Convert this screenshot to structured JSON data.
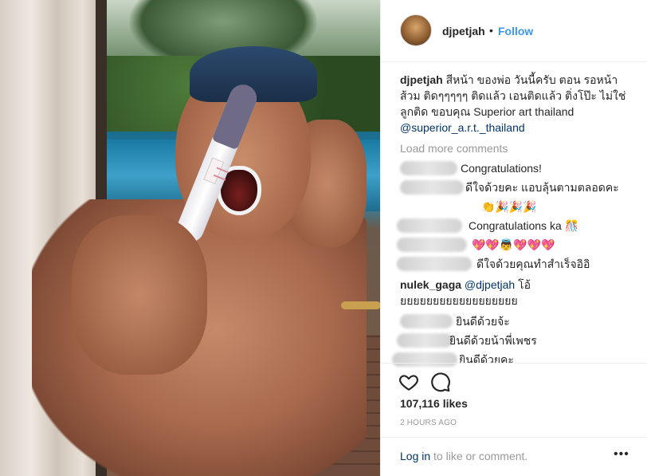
{
  "post": {
    "username": "djpetjah",
    "separator": "•",
    "follow_label": "Follow"
  },
  "caption": {
    "author": "djpetjah",
    "text": "สีหน้า ของพ่อ วันนี้ครับ ตอน รอหน้าส้วม ติดๆๆๆๆๆ ติดแล้ว เอนติดแล้ว ติ่งโป๊ะ ไม่ใช่ ลูกติด ขอบคุณ Superior art thailand",
    "mention": "@superior_a.r.t._thailand"
  },
  "load_more_label": "Load more comments",
  "comments": [
    {
      "text": "Congratulations!"
    },
    {
      "text": "ดีใจด้วยคะ แอบลุ้นตามตลอดคะ"
    },
    {
      "text": "👏🎉🎉🎉"
    },
    {
      "text": "Congratulations ka 🎊"
    },
    {
      "text": "💖💖👼💖💖💖"
    },
    {
      "text": "ดีใจด้วยคุณทำสำเร็จอิอิ"
    }
  ],
  "named_comment": {
    "author": "nulek_gaga",
    "mention": "@djpetjah",
    "text": "โอ้ยยยยยยยยยยยยยยยยยย"
  },
  "comments_after": [
    {
      "text": "ยินดีด้วยจ้ะ"
    },
    {
      "text": "ยินดีด้วยน้าพี่เพชร"
    },
    {
      "text": "ยินดีด้วยคะ"
    }
  ],
  "actions": {
    "like_icon": "heart-icon",
    "comment_icon": "comment-icon",
    "likes": "107,116 likes",
    "time": "2 HOURS AGO",
    "login_link": "Log in",
    "login_suffix": " to like or comment.",
    "more_label": "•••"
  }
}
